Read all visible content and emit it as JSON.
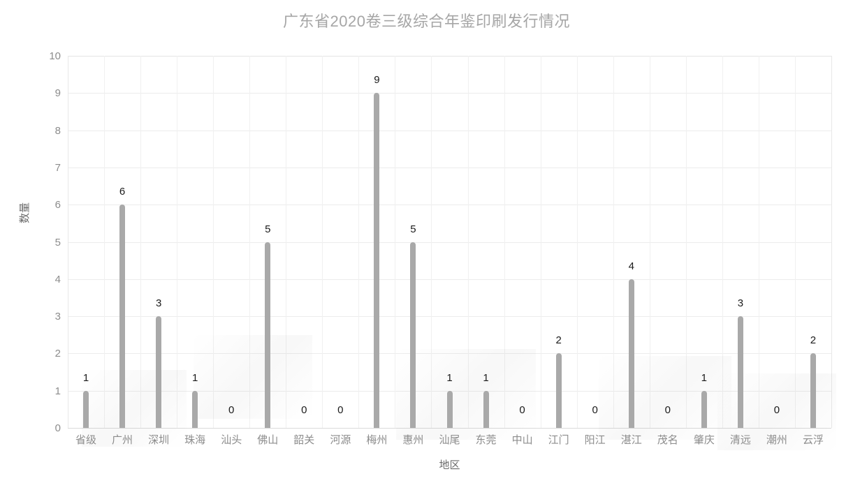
{
  "chart_data": {
    "type": "bar",
    "title": "广东省2020卷三级综合年鉴印刷发行情况",
    "xlabel": "地区",
    "ylabel": "数量",
    "ylim": [
      0,
      10
    ],
    "ytick_labels": [
      "10",
      "9",
      "8",
      "7",
      "6",
      "5",
      "4",
      "3",
      "2",
      "1",
      "0"
    ],
    "grid": true,
    "legend": "none",
    "bar_color": "#a9a9a9",
    "title_color": "#a6a6a6",
    "tick_color": "#8c8c8c",
    "label_color": "#1a1a1a",
    "categories": [
      "省级",
      "广州",
      "深圳",
      "珠海",
      "汕头",
      "佛山",
      "韶关",
      "河源",
      "梅州",
      "惠州",
      "汕尾",
      "东莞",
      "中山",
      "江门",
      "阳江",
      "湛江",
      "茂名",
      "肇庆",
      "清远",
      "潮州",
      "云浮"
    ],
    "values": [
      1,
      6,
      3,
      1,
      0,
      5,
      0,
      0,
      9,
      5,
      1,
      1,
      0,
      2,
      0,
      4,
      0,
      1,
      3,
      0,
      2
    ],
    "data_labels": [
      "1",
      "6",
      "3",
      "1",
      "0",
      "5",
      "0",
      "0",
      "9",
      "5",
      "1",
      "1",
      "0",
      "2",
      "0",
      "4",
      "0",
      "1",
      "3",
      "0",
      "2"
    ]
  }
}
